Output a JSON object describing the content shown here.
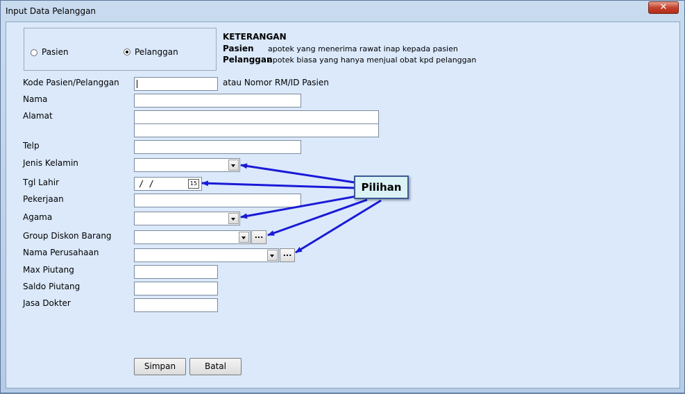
{
  "window": {
    "title": "Input Data Pelanggan",
    "close_symbol": "✕"
  },
  "customer_type": {
    "options": [
      {
        "label": "Pasien",
        "checked": false
      },
      {
        "label": "Pelanggan",
        "checked": true
      }
    ]
  },
  "keterangan": {
    "heading": "KETERANGAN",
    "items": [
      {
        "term": "Pasien",
        "desc": "apotek yang menerima rawat inap kepada pasien"
      },
      {
        "term": "Pelanggan",
        "desc": "apotek biasa yang hanya menjual obat kpd pelanggan"
      }
    ]
  },
  "form": {
    "kode_label": "Kode Pasien/Pelanggan",
    "kode_value": "",
    "kode_hint": "atau Nomor RM/ID Pasien",
    "nama_label": "Nama",
    "nama_value": "",
    "alamat_label": "Alamat",
    "alamat_line1": "",
    "alamat_line2": "",
    "telp_label": "Telp",
    "telp_value": "",
    "jenis_kelamin_label": "Jenis Kelamin",
    "jenis_kelamin_value": "",
    "tgl_lahir_label": "Tgl Lahir",
    "tgl_lahir_value": " /  /",
    "tgl_lahir_calendar": "15",
    "pekerjaan_label": "Pekerjaan",
    "pekerjaan_value": "",
    "agama_label": "Agama",
    "agama_value": "",
    "group_diskon_label": "Group Diskon Barang",
    "group_diskon_value": "",
    "nama_perusahaan_label": "Nama Perusahaan",
    "nama_perusahaan_value": "",
    "browse_label": "...",
    "max_piutang_label": "Max Piutang",
    "max_piutang_value": "",
    "saldo_piutang_label": "Saldo Piutang",
    "saldo_piutang_value": "",
    "jasa_dokter_label": "Jasa Dokter",
    "jasa_dokter_value": ""
  },
  "buttons": {
    "simpan": "Simpan",
    "batal": "Batal"
  },
  "annotation": {
    "callout_text": "Pilihan",
    "arrow_color": "#1a1ad6"
  }
}
